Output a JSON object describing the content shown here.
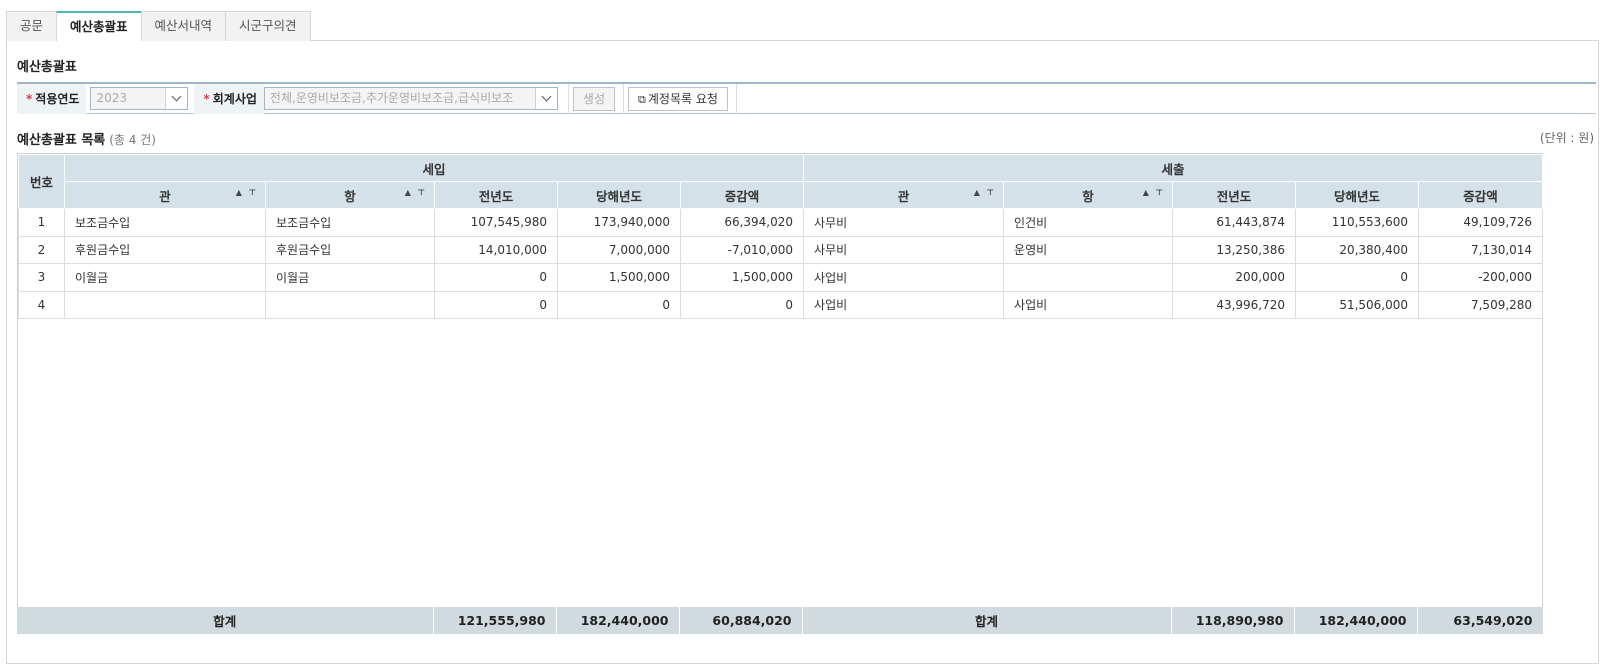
{
  "tabs": [
    "공문",
    "예산총괄표",
    "예산서내역",
    "시군구의견"
  ],
  "active_tab": "예산총괄표",
  "section_title": "예산총괄표",
  "filters": {
    "year_label": "적용연도",
    "year_value": "2023",
    "business_label": "회계사업",
    "business_value": "전체,운영비보조금,추가운영비보조금,급식비보조",
    "generate_button": "생성",
    "request_button": "계정목록 요청"
  },
  "list": {
    "title": "예산총괄표 목록",
    "count": "(총 4 건)",
    "unit": "(단위 : 원)"
  },
  "headers": {
    "no": "번호",
    "income_group": "세입",
    "expense_group": "세출",
    "gwan": "관",
    "hang": "항",
    "prev_year": "전년도",
    "curr_year": "당해년도",
    "diff": "증감액"
  },
  "rows": [
    {
      "no": "1",
      "in_gwan": "보조금수입",
      "in_hang": "보조금수입",
      "in_prev": "107,545,980",
      "in_curr": "173,940,000",
      "in_diff": "66,394,020",
      "out_gwan": "사무비",
      "out_hang": "인건비",
      "out_prev": "61,443,874",
      "out_curr": "110,553,600",
      "out_diff": "49,109,726"
    },
    {
      "no": "2",
      "in_gwan": "후원금수입",
      "in_hang": "후원금수입",
      "in_prev": "14,010,000",
      "in_curr": "7,000,000",
      "in_diff": "-7,010,000",
      "out_gwan": "사무비",
      "out_hang": "운영비",
      "out_prev": "13,250,386",
      "out_curr": "20,380,400",
      "out_diff": "7,130,014"
    },
    {
      "no": "3",
      "in_gwan": "이월금",
      "in_hang": "이월금",
      "in_prev": "0",
      "in_curr": "1,500,000",
      "in_diff": "1,500,000",
      "out_gwan": "사업비",
      "out_hang": "",
      "out_prev": "200,000",
      "out_curr": "0",
      "out_diff": "-200,000"
    },
    {
      "no": "4",
      "in_gwan": "",
      "in_hang": "",
      "in_prev": "0",
      "in_curr": "0",
      "in_diff": "0",
      "out_gwan": "사업비",
      "out_hang": "사업비",
      "out_prev": "43,996,720",
      "out_curr": "51,506,000",
      "out_diff": "7,509,280"
    }
  ],
  "totals": {
    "label": "합계",
    "in_prev": "121,555,980",
    "in_curr": "182,440,000",
    "in_diff": "60,884,020",
    "out_label": "합계",
    "out_prev": "118,890,980",
    "out_curr": "182,440,000",
    "out_diff": "63,549,020"
  },
  "colors": {
    "accent_tab": "#4cb8b8",
    "header_bg": "#d5e1e8",
    "footer_bg": "#d1dade",
    "required": "#e23b3b"
  }
}
